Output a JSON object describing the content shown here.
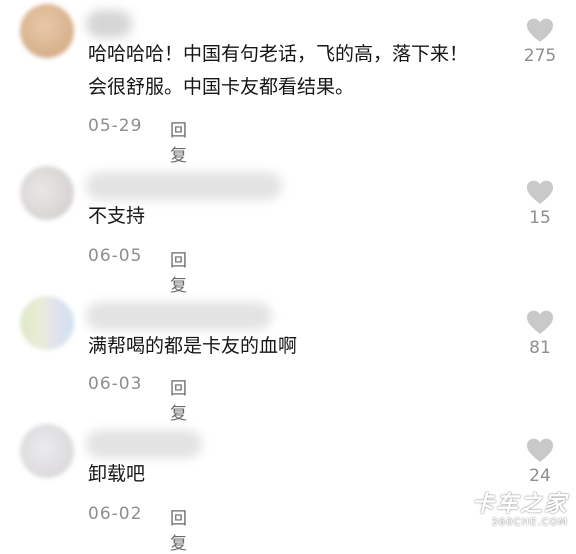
{
  "colors": {
    "text": "#161616",
    "meta": "#8e8e8e",
    "heart": "#c9c9c9"
  },
  "icons": {
    "like": "heart-icon"
  },
  "comments": [
    {
      "lines": [
        "哈哈哈哈！中国有句老话，飞的高，落下来！",
        "会很舒服。中国卡友都看结果。"
      ],
      "date": "05-29",
      "reply": "回复",
      "likes": "275"
    },
    {
      "lines": [
        "不支持"
      ],
      "date": "06-05",
      "reply": "回复",
      "likes": "15"
    },
    {
      "lines": [
        "满帮喝的都是卡友的血啊"
      ],
      "date": "06-03",
      "reply": "回复",
      "likes": "81"
    },
    {
      "lines": [
        "卸载吧"
      ],
      "date": "06-02",
      "reply": "回复",
      "likes": "24"
    }
  ],
  "watermark": {
    "logo_text": "卡车之家",
    "url_text": "360CHE.COM"
  }
}
